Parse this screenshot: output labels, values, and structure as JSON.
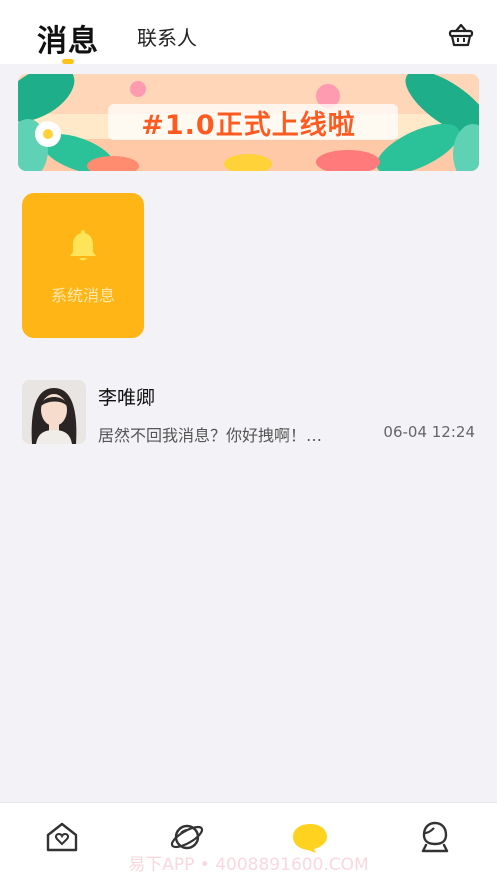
{
  "header": {
    "active_tab": "消息",
    "inactive_tab": "联系人",
    "right_icon": "basket-icon"
  },
  "banner": {
    "text": "#1.0正式上线啦"
  },
  "system_messages": {
    "label": "系统消息",
    "icon": "bell-icon"
  },
  "conversations": [
    {
      "name": "李唯卿",
      "preview": "居然不回我消息？你好拽啊！…",
      "time": "06-04 12:24"
    }
  ],
  "bottom_nav": {
    "items": [
      {
        "icon": "home-heart-icon"
      },
      {
        "icon": "planet-icon"
      },
      {
        "icon": "chat-bubble-icon",
        "active": true
      },
      {
        "icon": "profile-icon"
      }
    ]
  },
  "watermark": "易下APP • 4008891600.COM",
  "colors": {
    "accent": "#ffc21a",
    "system_card": "#ffb515",
    "banner_text": "#ff5a1f",
    "background": "#f2f2f7"
  }
}
